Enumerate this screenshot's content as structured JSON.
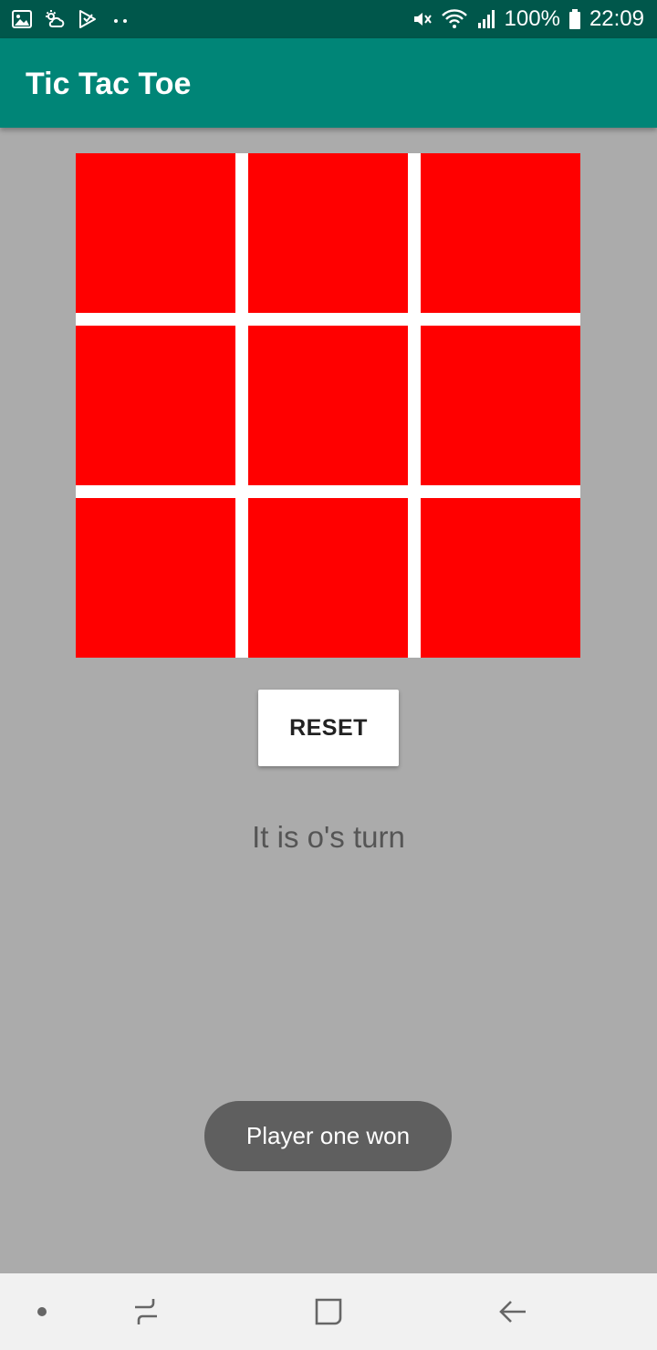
{
  "status_bar": {
    "battery_text": "100%",
    "time": "22:09",
    "left_icons": [
      "image-icon",
      "weather-icon",
      "play-store-icon",
      "more-notifications-icon"
    ],
    "right_icons": [
      "mute-icon",
      "wifi-icon",
      "signal-icon",
      "battery-icon"
    ]
  },
  "app_bar": {
    "title": "Tic Tac Toe",
    "color": "#008577",
    "status_color": "#00574b"
  },
  "board": {
    "rows": 3,
    "cols": 3,
    "cells": [
      "",
      "",
      "",
      "",
      "",
      "",
      "",
      "",
      ""
    ],
    "cell_color": "#ff0000",
    "divider_color": "#ffffff"
  },
  "controls": {
    "reset_label": "RESET"
  },
  "status": {
    "turn_text": "It is o's turn"
  },
  "toast": {
    "message": "Player one won"
  },
  "nav_bar": {
    "buttons": [
      "dot-icon",
      "recent-apps-icon",
      "home-icon",
      "back-icon"
    ]
  },
  "colors": {
    "background": "#ababab",
    "accent": "#008577"
  }
}
